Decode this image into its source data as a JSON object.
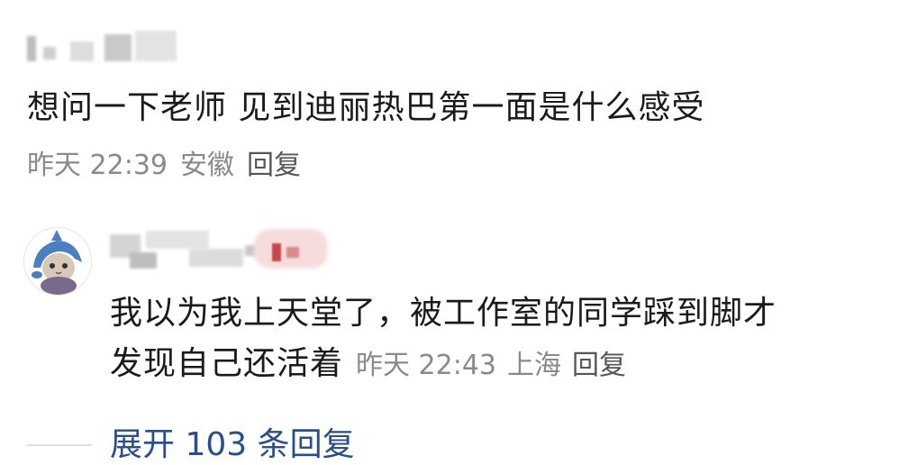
{
  "comment": {
    "text": "想问一下老师 见到迪丽热巴第一面是什么感受",
    "time": "昨天 22:39",
    "location": "安徽",
    "reply_label": "回复"
  },
  "reply": {
    "text_line1": "我以为我上天堂了，被工作室的同学踩到脚才",
    "text_line2": "发现自己还活着",
    "time": "昨天 22:43",
    "location": "上海",
    "reply_label": "回复"
  },
  "expand": {
    "label": "展开 103 条回复"
  },
  "colors": {
    "link_blue": "#2a4d8c",
    "meta_gray": "#8a8a8a",
    "text": "#1a1a1a",
    "badge_red": "#c8494c"
  }
}
